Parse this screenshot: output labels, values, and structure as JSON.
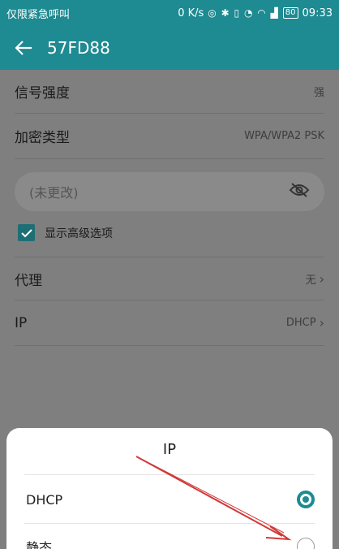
{
  "status_bar": {
    "carrier": "仅限紧急呼叫",
    "speed": "0 K/s",
    "icons": [
      "nfc-icon",
      "bluetooth-icon",
      "vibrate-icon",
      "alarm-icon",
      "wifi-icon",
      "signal-icon"
    ],
    "battery": "80",
    "time": "09:33"
  },
  "app_bar": {
    "title": "57FD88"
  },
  "rows": {
    "signal": {
      "label": "信号强度",
      "value": "强"
    },
    "encryption": {
      "label": "加密类型",
      "value": "WPA/WPA2 PSK"
    },
    "proxy": {
      "label": "代理",
      "value": "无"
    },
    "ip": {
      "label": "IP",
      "value": "DHCP"
    }
  },
  "password": {
    "placeholder": "(未更改)"
  },
  "advanced": {
    "label": "显示高级选项",
    "checked": true
  },
  "sheet": {
    "title": "IP",
    "options": [
      {
        "label": "DHCP",
        "selected": true
      },
      {
        "label": "静态",
        "selected": false
      }
    ]
  },
  "colors": {
    "accent": "#1e8a91",
    "annotation": "#d03a3a"
  }
}
